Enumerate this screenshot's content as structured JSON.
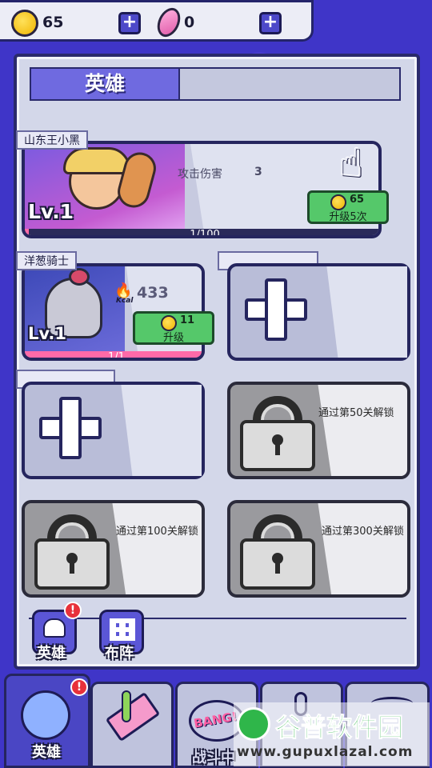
{
  "currency": {
    "coins": "65",
    "gems": "0"
  },
  "panel": {
    "title": "英雄"
  },
  "heroes": [
    {
      "name": "山东王小黑",
      "level": "Lv.1",
      "stat_label": "攻击伤害",
      "stat_value": "3",
      "upgrade_cost": "65",
      "upgrade_label": "升级5次",
      "progress_text": "1/100",
      "progress": 0.01
    },
    {
      "name": "洋葱骑士",
      "level": "Lv.1",
      "kcal_label": "Kcal",
      "kcal_value": "433",
      "upgrade_cost": "11",
      "upgrade_label": "升级",
      "progress_text": "1/1",
      "progress": 1.0
    }
  ],
  "locked_slots": [
    {
      "text": "通过第50关解锁"
    },
    {
      "text": "通过第100关解锁"
    },
    {
      "text": "通过第300关解锁"
    }
  ],
  "sub_buttons": [
    {
      "label": "英雄",
      "alert": "!"
    },
    {
      "label": "布阵"
    }
  ],
  "bottom_nav": [
    {
      "label": "英雄",
      "alert": "!"
    },
    {
      "label": ""
    },
    {
      "label": "战斗中",
      "badge": "BANG!"
    },
    {
      "label": ""
    },
    {
      "label": ""
    }
  ],
  "watermark": {
    "text": "谷普软件园",
    "url": "www.gupuxlazal.com"
  },
  "colors": {
    "background": "#3f35c8",
    "panel": "#d3d7e9",
    "upgrade_green": "#55c86a",
    "alert_red": "#e8313a"
  }
}
